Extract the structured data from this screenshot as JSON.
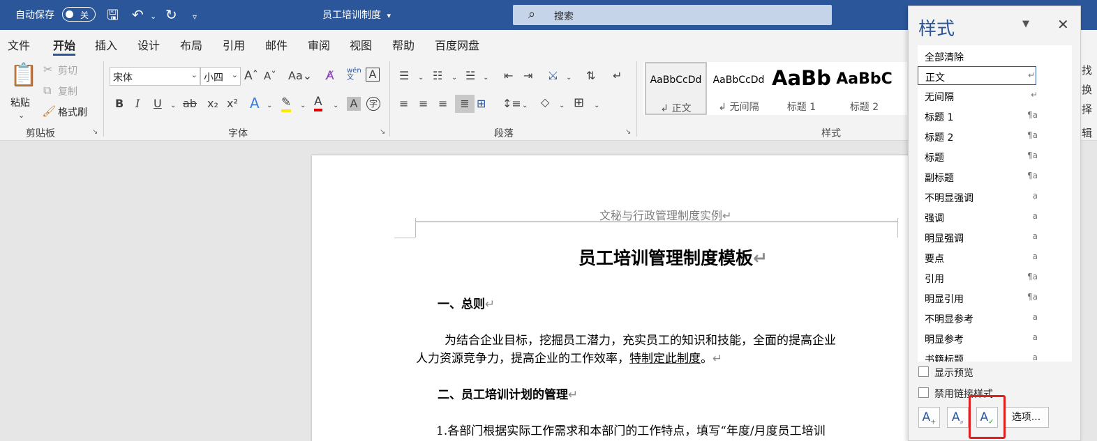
{
  "titlebar": {
    "autosave_label": "自动保存",
    "autosave_state": "关",
    "doc_title": "员工培训制度",
    "doc_title_caret": "▾",
    "search_placeholder": "搜索"
  },
  "menu": {
    "tabs": [
      "文件",
      "开始",
      "插入",
      "设计",
      "布局",
      "引用",
      "邮件",
      "审阅",
      "视图",
      "帮助",
      "百度网盘"
    ],
    "active": "开始"
  },
  "ribbon": {
    "clipboard": {
      "label": "剪贴板",
      "paste": "粘贴",
      "cut": "剪切",
      "copy": "复制",
      "format_painter": "格式刷"
    },
    "font": {
      "label": "字体",
      "font_name": "宋体",
      "font_size": "小四",
      "phonetic": "wén"
    },
    "paragraph": {
      "label": "段落"
    },
    "styles": {
      "label": "样式",
      "gallery": [
        {
          "preview": "AaBbCcDd",
          "name": "↲ 正文"
        },
        {
          "preview": "AaBbCcDd",
          "name": "↲ 无间隔"
        },
        {
          "preview": "AaBb",
          "name": "标题 1"
        },
        {
          "preview": "AaBbC",
          "name": "标题 2"
        }
      ]
    },
    "right_clipped": [
      "找",
      "换",
      "择",
      "辑"
    ]
  },
  "document": {
    "header": "文秘与行政管理制度实例",
    "title": "员工培训管理制度模板",
    "h1": "一、总则",
    "p1_line1": "为结合企业目标，挖掘员工潜力，充实员工的知识和技能，全面的提高企业",
    "p1_line2_a": "人力资源竞争力，提高企业的工作效率，",
    "p1_line2_link": "特制定此制度",
    "p1_line2_b": "。",
    "h2": "二、员工培训计划的管理",
    "p2_line1": "1.各部门根据实际工作需求和本部门的工作特点，填写“年度/月度员工培训",
    "para_mark": "↵"
  },
  "styles_pane": {
    "title": "样式",
    "items": [
      {
        "name": "全部清除",
        "mark": ""
      },
      {
        "name": "正文",
        "mark": "↵"
      },
      {
        "name": "无间隔",
        "mark": "↵"
      },
      {
        "name": "标题 1",
        "mark": "¶a"
      },
      {
        "name": "标题 2",
        "mark": "¶a"
      },
      {
        "name": "标题",
        "mark": "¶a"
      },
      {
        "name": "副标题",
        "mark": "¶a"
      },
      {
        "name": "不明显强调",
        "mark": "a"
      },
      {
        "name": "强调",
        "mark": "a"
      },
      {
        "name": "明显强调",
        "mark": "a"
      },
      {
        "name": "要点",
        "mark": "a"
      },
      {
        "name": "引用",
        "mark": "¶a"
      },
      {
        "name": "明显引用",
        "mark": "¶a"
      },
      {
        "name": "不明显参考",
        "mark": "a"
      },
      {
        "name": "明显参考",
        "mark": "a"
      },
      {
        "name": "书籍标题",
        "mark": "a"
      }
    ],
    "selected": "正文",
    "show_preview": "显示预览",
    "disable_linked": "禁用链接样式",
    "options_button": "选项...",
    "accent_color": "#2b579a",
    "highlight_color": "#e02020"
  }
}
